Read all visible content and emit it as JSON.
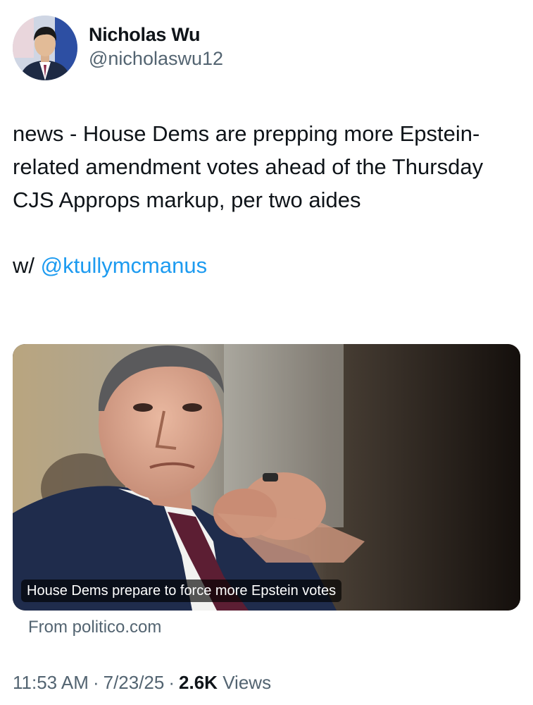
{
  "author": {
    "display_name": "Nicholas Wu",
    "handle": "@nicholaswu12"
  },
  "tweet": {
    "text_main": "news - House Dems are prepping more Epstein-related amendment votes ahead of the Thursday CJS Approps markup, per two aides",
    "text_with_prefix": "w/ ",
    "mention": "@ktullymcmanus"
  },
  "card": {
    "caption": "House Dems prepare to force more Epstein votes",
    "source": "From politico.com"
  },
  "meta": {
    "time": "11:53 AM",
    "date": "7/23/25",
    "separator": "·",
    "views_count": "2.6K",
    "views_label": "Views"
  },
  "colors": {
    "link": "#1d9bf0",
    "muted": "#536471",
    "text": "#0f1419"
  }
}
